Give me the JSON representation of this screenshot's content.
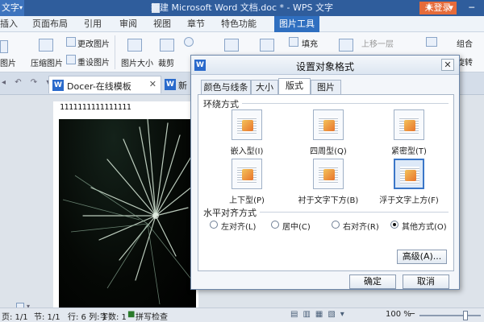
{
  "titlebar": {
    "app_menu": "文字",
    "title": "新建 Microsoft Word 文档.doc * - WPS 文字",
    "signin": "未登录",
    "controls": "♦ ▾ ─"
  },
  "menubar": {
    "items": [
      "插入",
      "页面布局",
      "引用",
      "审阅",
      "视图",
      "章节",
      "特色功能",
      "图片工具"
    ]
  },
  "ribbon": {
    "items": [
      "更改图片",
      "压缩图片",
      "重设图片",
      "图片大小",
      "裁剪",
      "填充",
      "上移一层",
      "组合",
      "旋转"
    ],
    "left_cut": "图片"
  },
  "doctabs": {
    "active": "Docer-在线模板",
    "second": "新"
  },
  "document": {
    "text_line": "1111111111111111"
  },
  "dialog": {
    "title": "设置对象格式",
    "tabs": [
      "颜色与线条",
      "大小",
      "版式",
      "图片"
    ],
    "active_tab": "版式",
    "wrap_section": "环绕方式",
    "wrap_options": [
      "嵌入型(I)",
      "四周型(Q)",
      "紧密型(T)",
      "上下型(P)",
      "衬于文字下方(B)",
      "浮于文字上方(F)"
    ],
    "selected_wrap": "浮于文字上方(F)",
    "align_section": "水平对齐方式",
    "align_options": [
      "左对齐(L)",
      "居中(C)",
      "右对齐(R)",
      "其他方式(O)"
    ],
    "selected_align": "其他方式(O)",
    "advanced_button": "高级(A)...",
    "ok_button": "确定",
    "cancel_button": "取消"
  },
  "statusbar": {
    "page": "页: 1/1",
    "section": "节: 1/1",
    "position": "行: 6  列: 1",
    "words": "字数: 1",
    "spellcheck": "拼写检查",
    "zoom": "100 %"
  },
  "colors": {
    "titlebar": "#2f5d9c",
    "accent": "#2f6fc0",
    "signin": "#e66b3a"
  }
}
